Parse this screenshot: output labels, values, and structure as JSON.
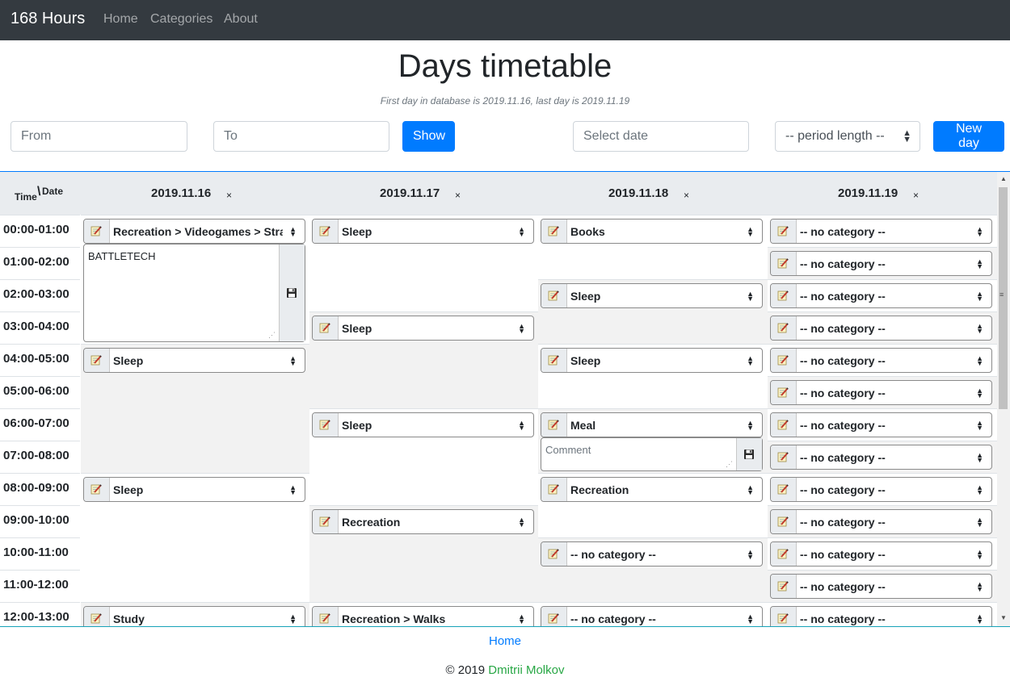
{
  "navbar": {
    "brand": "168 Hours",
    "links": [
      "Home",
      "Categories",
      "About"
    ]
  },
  "page": {
    "title": "Days timetable",
    "subtitle": "First day in database is 2019.11.16, last day is 2019.11.19"
  },
  "controls": {
    "from_placeholder": "From",
    "to_placeholder": "To",
    "show_label": "Show",
    "date_placeholder": "Select date",
    "period_label": "-- period length --",
    "new_day_label": "New day"
  },
  "table": {
    "corner_time": "Time",
    "corner_date": "Date",
    "remove_glyph": "×",
    "times": [
      "00:00-01:00",
      "01:00-02:00",
      "02:00-03:00",
      "03:00-04:00",
      "04:00-05:00",
      "05:00-06:00",
      "06:00-07:00",
      "07:00-08:00",
      "08:00-09:00",
      "09:00-10:00",
      "10:00-11:00",
      "11:00-12:00",
      "12:00-13:00"
    ],
    "days": [
      {
        "date": "2019.11.16",
        "blocks": [
          {
            "start": 0,
            "hours": 4,
            "category": "Recreation > Videogames > Strategy",
            "comment": "BATTLETECH"
          },
          {
            "start": 4,
            "hours": 4,
            "category": "Sleep"
          },
          {
            "start": 8,
            "hours": 4,
            "category": "Sleep"
          },
          {
            "start": 12,
            "hours": 1,
            "category": "Study"
          }
        ]
      },
      {
        "date": "2019.11.17",
        "blocks": [
          {
            "start": 0,
            "hours": 3,
            "category": "Sleep"
          },
          {
            "start": 3,
            "hours": 3,
            "category": "Sleep"
          },
          {
            "start": 6,
            "hours": 3,
            "category": "Sleep"
          },
          {
            "start": 9,
            "hours": 3,
            "category": "Recreation"
          },
          {
            "start": 12,
            "hours": 1,
            "category": "Recreation > Walks"
          }
        ]
      },
      {
        "date": "2019.11.18",
        "blocks": [
          {
            "start": 0,
            "hours": 2,
            "category": "Books"
          },
          {
            "start": 2,
            "hours": 2,
            "category": "Sleep"
          },
          {
            "start": 4,
            "hours": 2,
            "category": "Sleep"
          },
          {
            "start": 6,
            "hours": 2,
            "category": "Meal",
            "comment_placeholder": "Comment"
          },
          {
            "start": 8,
            "hours": 2,
            "category": "Recreation"
          },
          {
            "start": 10,
            "hours": 2,
            "category": "-- no category --"
          },
          {
            "start": 12,
            "hours": 1,
            "category": "-- no category --"
          }
        ]
      },
      {
        "date": "2019.11.19",
        "blocks": [
          {
            "start": 0,
            "hours": 1,
            "category": "-- no category --"
          },
          {
            "start": 1,
            "hours": 1,
            "category": "-- no category --"
          },
          {
            "start": 2,
            "hours": 1,
            "category": "-- no category --"
          },
          {
            "start": 3,
            "hours": 1,
            "category": "-- no category --"
          },
          {
            "start": 4,
            "hours": 1,
            "category": "-- no category --"
          },
          {
            "start": 5,
            "hours": 1,
            "category": "-- no category --"
          },
          {
            "start": 6,
            "hours": 1,
            "category": "-- no category --"
          },
          {
            "start": 7,
            "hours": 1,
            "category": "-- no category --"
          },
          {
            "start": 8,
            "hours": 1,
            "category": "-- no category --"
          },
          {
            "start": 9,
            "hours": 1,
            "category": "-- no category --"
          },
          {
            "start": 10,
            "hours": 1,
            "category": "-- no category --"
          },
          {
            "start": 11,
            "hours": 1,
            "category": "-- no category --"
          },
          {
            "start": 12,
            "hours": 1,
            "category": "-- no category --"
          }
        ]
      }
    ]
  },
  "footer": {
    "home_link": "Home",
    "copyright": "© 2019",
    "author": "Dmitrii Molkov"
  },
  "colors": {
    "navbar_bg": "#343a40",
    "primary": "#007bff",
    "author": "#28a745",
    "header_bg": "#e9ecef",
    "block_shade": "#f2f2f2"
  },
  "icons": {
    "category_icon": "notepad-pencil-icon",
    "save_icon": "floppy-disk-icon",
    "select_arrow": "up-down-arrows-icon"
  }
}
